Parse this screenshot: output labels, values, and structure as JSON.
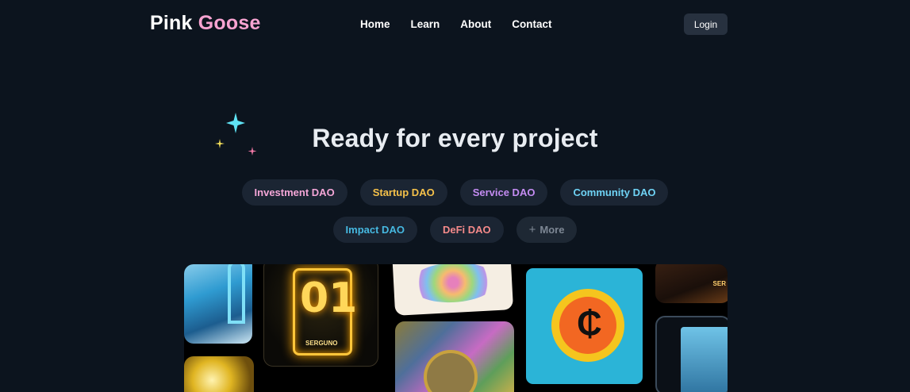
{
  "header": {
    "logo_part1": "Pink",
    "logo_part2": "Goose",
    "nav": [
      "Home",
      "Learn",
      "About",
      "Contact"
    ],
    "login_label": "Login"
  },
  "hero": {
    "title": "Ready for every project"
  },
  "tags": {
    "row1": [
      {
        "label": "Investment DAO",
        "color": "#f4a6d7"
      },
      {
        "label": "Startup DAO",
        "color": "#f5c14a"
      },
      {
        "label": "Service DAO",
        "color": "#c48cf2"
      },
      {
        "label": "Community DAO",
        "color": "#6fd3f5"
      }
    ],
    "row2": [
      {
        "label": "Impact DAO",
        "color": "#46b8e0"
      },
      {
        "label": "DeFi DAO",
        "color": "#f58a8a"
      }
    ],
    "more_label": "More",
    "more_color": "#7d8794"
  },
  "gallery": {
    "card_labels": {
      "c2_number": "01",
      "c2_caption": "SERGUNO",
      "c5_symbol": "₵",
      "c6_caption": "SER"
    }
  },
  "colors": {
    "background": "#0c141e",
    "logo_accent": "#f7a3d1",
    "login_bg": "#27313f",
    "tag_bg": "#1b2533"
  }
}
